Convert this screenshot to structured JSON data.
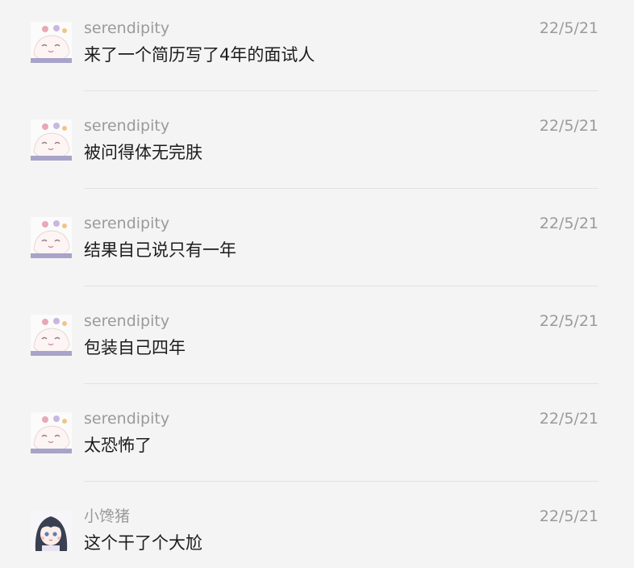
{
  "messages": [
    {
      "sender": "serendipity",
      "time": "22/5/21",
      "text": "来了一个简历写了4年的面试人",
      "avatar": "cat-avatar-icon"
    },
    {
      "sender": "serendipity",
      "time": "22/5/21",
      "text": "被问得体无完肤",
      "avatar": "cat-avatar-icon"
    },
    {
      "sender": "serendipity",
      "time": "22/5/21",
      "text": "结果自己说只有一年",
      "avatar": "cat-avatar-icon"
    },
    {
      "sender": "serendipity",
      "time": "22/5/21",
      "text": "包装自己四年",
      "avatar": "cat-avatar-icon"
    },
    {
      "sender": "serendipity",
      "time": "22/5/21",
      "text": "太恐怖了",
      "avatar": "cat-avatar-icon"
    },
    {
      "sender": "小馋猪",
      "time": "22/5/21",
      "text": "这个干了个大尬",
      "avatar": "anime-girl-avatar-icon"
    }
  ]
}
